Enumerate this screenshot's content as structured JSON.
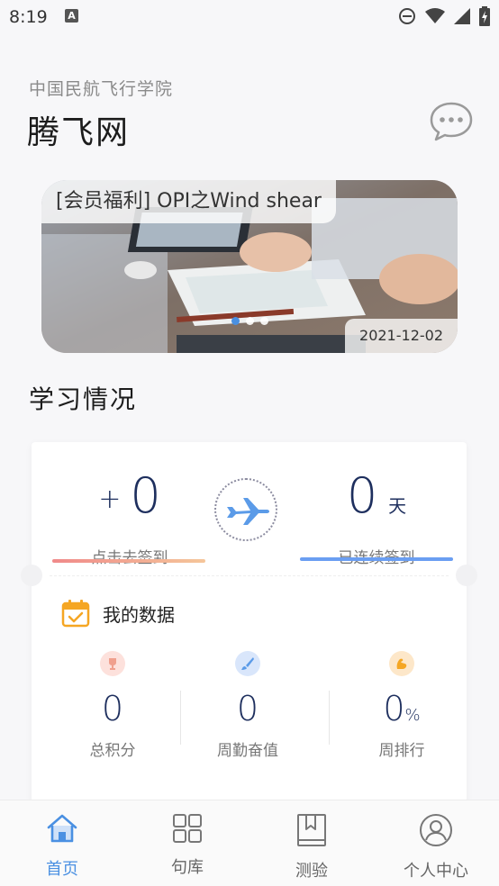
{
  "status": {
    "time": "8:19"
  },
  "header": {
    "subtitle": "中国民航飞行学院",
    "title": "腾飞网"
  },
  "banner": {
    "caption": "[会员福利] OPI之Wind shear",
    "date": "2021-12-02",
    "slide_count": 3,
    "active_slide": 1
  },
  "learning": {
    "section_title": "学习情况",
    "checkin": {
      "prefix": "+",
      "value": "0",
      "label": "点击去签到"
    },
    "streak": {
      "value": "0",
      "unit": "天",
      "label": "已连续签到"
    },
    "mydata": {
      "title": "我的数据",
      "stats": [
        {
          "value": "0",
          "label": "总积分",
          "icon": "trophy-icon"
        },
        {
          "value": "0",
          "label": "周勤奋值",
          "icon": "brush-icon"
        },
        {
          "value": "0",
          "suffix": "%",
          "label": "周排行",
          "icon": "muscle-icon"
        }
      ]
    }
  },
  "tabs": [
    {
      "label": "首页",
      "icon": "home-icon",
      "active": true
    },
    {
      "label": "句库",
      "icon": "grid-icon",
      "active": false
    },
    {
      "label": "测验",
      "icon": "book-icon",
      "active": false
    },
    {
      "label": "个人中心",
      "icon": "user-icon",
      "active": false
    }
  ],
  "colors": {
    "accent": "#4a90e2",
    "navy": "#1e2f5e",
    "warm": "#f08a8a"
  }
}
